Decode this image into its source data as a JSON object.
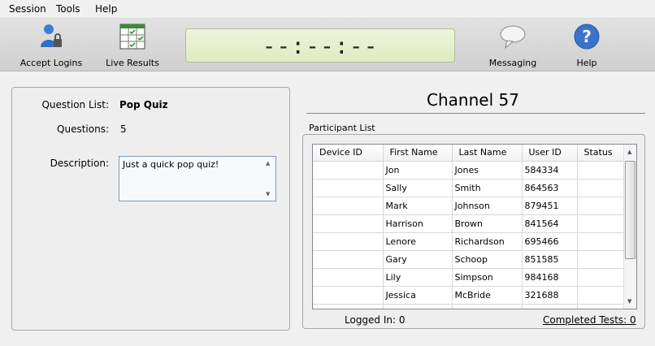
{
  "menu": {
    "items": [
      "Session",
      "Tools",
      "Help"
    ]
  },
  "toolbar": {
    "accept_logins": {
      "label": "Accept Logins",
      "icon": "user-login-icon"
    },
    "live_results": {
      "label": "Live Results",
      "icon": "results-grid-icon"
    },
    "timer": "--:--:--",
    "messaging": {
      "label": "Messaging",
      "icon": "speech-bubble-icon"
    },
    "help": {
      "label": "Help",
      "icon": "help-question-icon"
    }
  },
  "quiz": {
    "question_list_label": "Question List:",
    "question_list_value": "Pop Quiz",
    "questions_label": "Questions:",
    "questions_value": "5",
    "description_label": "Description:",
    "description_value": "Just a quick pop quiz!"
  },
  "channel": {
    "title": "Channel 57"
  },
  "participants": {
    "group_label": "Participant List",
    "columns": [
      "Device ID",
      "First Name",
      "Last Name",
      "User ID",
      "Status"
    ],
    "rows": [
      [
        "",
        "Jon",
        "Jones",
        "584334",
        ""
      ],
      [
        "",
        "Sally",
        "Smith",
        "864563",
        ""
      ],
      [
        "",
        "Mark",
        "Johnson",
        "879451",
        ""
      ],
      [
        "",
        "Harrison",
        "Brown",
        "841564",
        ""
      ],
      [
        "",
        "Lenore",
        "Richardson",
        "695466",
        ""
      ],
      [
        "",
        "Gary",
        "Schoop",
        "851585",
        ""
      ],
      [
        "",
        "Lily",
        "Simpson",
        "984168",
        ""
      ],
      [
        "",
        "Jessica",
        "McBride",
        "321688",
        ""
      ]
    ]
  },
  "footer": {
    "logged_in": "Logged In: 0",
    "completed_tests": "Completed Tests:  0"
  }
}
